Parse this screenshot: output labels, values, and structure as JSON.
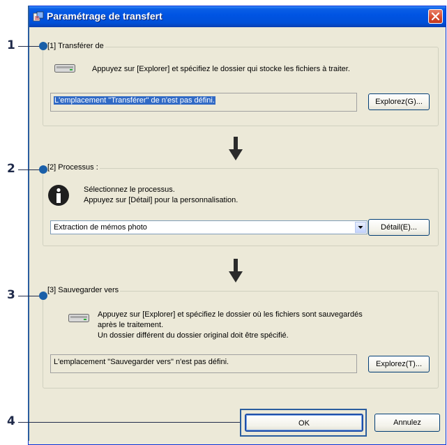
{
  "window": {
    "title": "Paramétrage de transfert"
  },
  "callouts": [
    "1",
    "2",
    "3",
    "4"
  ],
  "transfer_from": {
    "group_label": "[1] Transférer de",
    "instruction": "Appuyez sur [Explorer] et spécifiez le dossier qui stocke les fichiers à traiter.",
    "location_text": "L'emplacement \"Transférer\" de n'est pas défini.",
    "browse_label": "Explorez(G)..."
  },
  "process": {
    "group_label": "[2] Processus :",
    "info_line1": "Sélectionnez le processus.",
    "info_line2": "Appuyez sur [Détail] pour la personnalisation.",
    "selected_option": "Extraction de mémos photo",
    "detail_label": "Détail(E)..."
  },
  "save_to": {
    "group_label": "[3] Sauvegarder vers",
    "instruction_line1": "Appuyez sur [Explorer] et spécifiez le dossier où les fichiers sont sauvegardés",
    "instruction_line2": "après le traitement.",
    "instruction_line3": "Un dossier différent du dossier original doit être spécifié.",
    "location_text": "L'emplacement \"Sauvegarder vers\" n'est pas défini.",
    "browse_label": "Explorez(T)..."
  },
  "footer": {
    "ok_label": "OK",
    "cancel_label": "Annulez"
  },
  "icons": [
    "app-icon",
    "close-icon",
    "drive-icon",
    "info-icon",
    "arrow-down-icon",
    "chevron-down-icon"
  ]
}
